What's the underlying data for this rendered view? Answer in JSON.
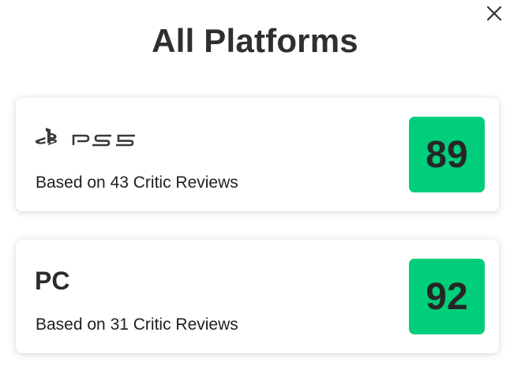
{
  "title": "All Platforms",
  "score_color": "#00ce7a",
  "platforms": [
    {
      "name": "PS5",
      "display": "logo",
      "logo_icon": "playstation-5-logo-icon",
      "reviews_text": "Based on 43 Critic Reviews",
      "score": "89"
    },
    {
      "name": "PC",
      "display": "text",
      "reviews_text": "Based on 31 Critic Reviews",
      "score": "92"
    }
  ]
}
